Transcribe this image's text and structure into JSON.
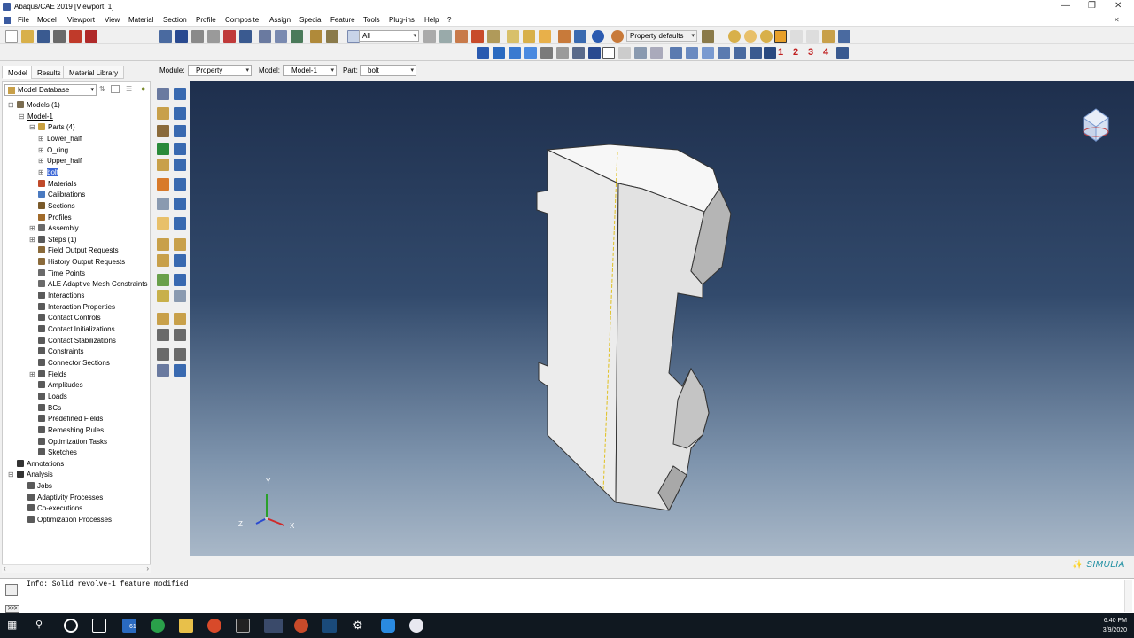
{
  "window": {
    "title": "Abaqus/CAE 2019 [Viewport: 1]"
  },
  "menu": [
    {
      "label": "File"
    },
    {
      "label": "Model"
    },
    {
      "label": "Viewport"
    },
    {
      "label": "View"
    },
    {
      "label": "Material"
    },
    {
      "label": "Section"
    },
    {
      "label": "Profile"
    },
    {
      "label": "Composite"
    },
    {
      "label": "Assign"
    },
    {
      "label": "Special"
    },
    {
      "label": "Feature"
    },
    {
      "label": "Tools"
    },
    {
      "label": "Plug-ins"
    },
    {
      "label": "Help"
    },
    {
      "label": "?"
    }
  ],
  "toolbar": {
    "selection_filter": "All",
    "render_style": "Property defaults",
    "view_numbers": [
      "1",
      "2",
      "3",
      "4"
    ]
  },
  "context": {
    "module_label": "Module:",
    "module_value": "Property",
    "model_label": "Model:",
    "model_value": "Model-1",
    "part_label": "Part:",
    "part_value": "bolt"
  },
  "tabs": [
    {
      "label": "Model"
    },
    {
      "label": "Results"
    },
    {
      "label": "Material Library"
    }
  ],
  "tree_selector": "Model Database",
  "tree": [
    {
      "label": "Models (1)",
      "level": 0,
      "exp": "-",
      "color": "#7a6c50"
    },
    {
      "label": "Model-1",
      "level": 1,
      "exp": "-",
      "color": "",
      "underline": true
    },
    {
      "label": "Parts (4)",
      "level": 2,
      "exp": "-",
      "color": "#c8a040"
    },
    {
      "label": "Lower_half",
      "level": 3,
      "exp": "+",
      "color": ""
    },
    {
      "label": "O_ring",
      "level": 3,
      "exp": "+",
      "color": ""
    },
    {
      "label": "Upper_half",
      "level": 3,
      "exp": "+",
      "color": ""
    },
    {
      "label": "bolt",
      "level": 3,
      "exp": "+",
      "color": "",
      "hl": true
    },
    {
      "label": "Materials",
      "level": 2,
      "exp": "",
      "color": "#c04a2a"
    },
    {
      "label": "Calibrations",
      "level": 2,
      "exp": "",
      "color": "#4a7ac0"
    },
    {
      "label": "Sections",
      "level": 2,
      "exp": "",
      "color": "#7a5a2a"
    },
    {
      "label": "Profiles",
      "level": 2,
      "exp": "",
      "color": "#a06a2a"
    },
    {
      "label": "Assembly",
      "level": 2,
      "exp": "+",
      "color": "#6a6a6a"
    },
    {
      "label": "Steps (1)",
      "level": 2,
      "exp": "+",
      "color": "#5a5a5a"
    },
    {
      "label": "Field Output Requests",
      "level": 2,
      "exp": "",
      "color": "#8a6a3a"
    },
    {
      "label": "History Output Requests",
      "level": 2,
      "exp": "",
      "color": "#8a6a3a"
    },
    {
      "label": "Time Points",
      "level": 2,
      "exp": "",
      "color": "#6a6a6a"
    },
    {
      "label": "ALE Adaptive Mesh Constraints",
      "level": 2,
      "exp": "",
      "color": "#6a6a6a"
    },
    {
      "label": "Interactions",
      "level": 2,
      "exp": "",
      "color": "#5a5a5a"
    },
    {
      "label": "Interaction Properties",
      "level": 2,
      "exp": "",
      "color": "#5a5a5a"
    },
    {
      "label": "Contact Controls",
      "level": 2,
      "exp": "",
      "color": "#5a5a5a"
    },
    {
      "label": "Contact Initializations",
      "level": 2,
      "exp": "",
      "color": "#5a5a5a"
    },
    {
      "label": "Contact Stabilizations",
      "level": 2,
      "exp": "",
      "color": "#5a5a5a"
    },
    {
      "label": "Constraints",
      "level": 2,
      "exp": "",
      "color": "#5a5a5a"
    },
    {
      "label": "Connector Sections",
      "level": 2,
      "exp": "",
      "color": "#5a5a5a"
    },
    {
      "label": "Fields",
      "level": 2,
      "exp": "+",
      "color": "#5a5a5a"
    },
    {
      "label": "Amplitudes",
      "level": 2,
      "exp": "",
      "color": "#5a5a5a"
    },
    {
      "label": "Loads",
      "level": 2,
      "exp": "",
      "color": "#5a5a5a"
    },
    {
      "label": "BCs",
      "level": 2,
      "exp": "",
      "color": "#5a5a5a"
    },
    {
      "label": "Predefined Fields",
      "level": 2,
      "exp": "",
      "color": "#5a5a5a"
    },
    {
      "label": "Remeshing Rules",
      "level": 2,
      "exp": "",
      "color": "#5a5a5a"
    },
    {
      "label": "Optimization Tasks",
      "level": 2,
      "exp": "",
      "color": "#5a5a5a"
    },
    {
      "label": "Sketches",
      "level": 2,
      "exp": "",
      "color": "#5a5a5a"
    },
    {
      "label": "Annotations",
      "level": 0,
      "exp": "",
      "color": "#333"
    },
    {
      "label": "Analysis",
      "level": 0,
      "exp": "-",
      "color": "#333"
    },
    {
      "label": "Jobs",
      "level": 1,
      "exp": "",
      "color": "#5a5a5a"
    },
    {
      "label": "Adaptivity Processes",
      "level": 1,
      "exp": "",
      "color": "#5a5a5a"
    },
    {
      "label": "Co-executions",
      "level": 1,
      "exp": "",
      "color": "#5a5a5a"
    },
    {
      "label": "Optimization Processes",
      "level": 1,
      "exp": "",
      "color": "#5a5a5a"
    }
  ],
  "triad": {
    "x": "X",
    "y": "Y",
    "z": "Z"
  },
  "brand": "SIMULIA",
  "message": "Info: Solid revolve-1 feature modified",
  "clock": {
    "time": "6:40 PM",
    "date": "3/9/2020"
  },
  "taskbar_badge": "61"
}
